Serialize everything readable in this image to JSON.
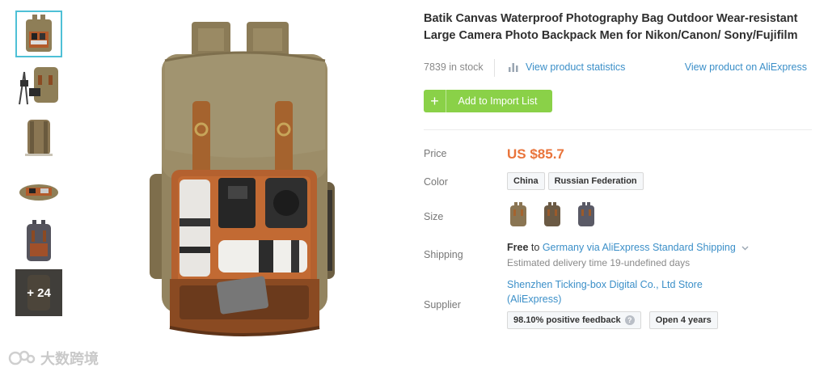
{
  "thumbnails": [
    {
      "name": "thumb-front-open",
      "active": true
    },
    {
      "name": "thumb-with-tripod",
      "active": false
    },
    {
      "name": "thumb-back",
      "active": false
    },
    {
      "name": "thumb-lying",
      "active": false
    },
    {
      "name": "thumb-dark-variant",
      "active": false
    },
    {
      "name": "thumb-more",
      "active": false
    }
  ],
  "more_count": "+ 24",
  "product": {
    "title": "Batik Canvas Waterproof Photography Bag Outdoor Wear-resistant Large Camera Photo Backpack Men for Nikon/Canon/ Sony/Fujifilm",
    "stock": "7839 in stock",
    "stats_link": "View product statistics",
    "ali_link": "View product on AliExpress",
    "import_button": "Add to Import List",
    "import_icon": "+"
  },
  "details": {
    "price_label": "Price",
    "price": "US $85.7",
    "color_label": "Color",
    "color_options": [
      "China",
      "Russian Federation"
    ],
    "size_label": "Size",
    "size_swatches": [
      {
        "name": "khaki",
        "color": "#8a7553"
      },
      {
        "name": "coffee",
        "color": "#6b5a44"
      },
      {
        "name": "gray",
        "color": "#5a5a66"
      }
    ],
    "shipping_label": "Shipping",
    "shipping_free": "Free",
    "shipping_to": "to",
    "shipping_method": "Germany via AliExpress Standard Shipping",
    "delivery": "Estimated delivery time 19-undefined days",
    "supplier_label": "Supplier",
    "supplier_name": "Shenzhen Ticking-box Digital Co., Ltd Store (AliExpress)",
    "feedback": "98.10% positive feedback",
    "help_icon": "?",
    "open_years": "Open 4 years"
  },
  "watermark": "大数跨境",
  "colors": {
    "accent_green": "#8ad148",
    "link_blue": "#3b8fc8",
    "price_orange": "#e9743b",
    "active_border": "#4ec0d6"
  }
}
